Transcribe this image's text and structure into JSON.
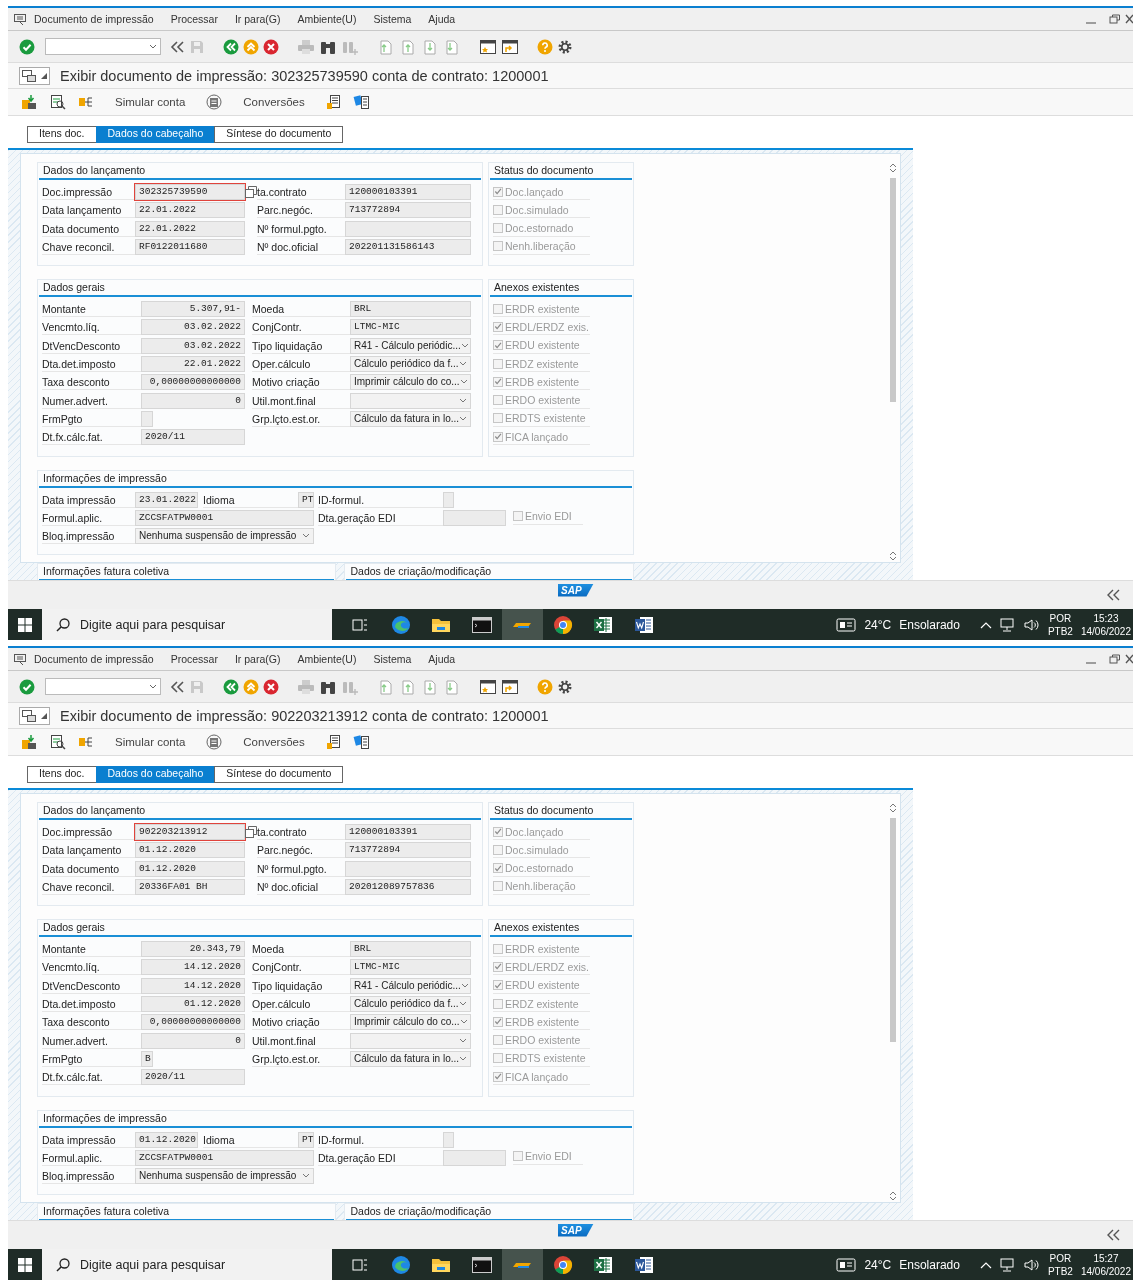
{
  "screens": [
    {
      "menu": [
        "Documento de impressão",
        "Processar",
        "Ir para(G)",
        "Ambiente(U)",
        "Sistema",
        "Ajuda"
      ],
      "title": "Exibir documento de impressão: 302325739590 conta de contrato: 1200001",
      "app_toolbar": [
        "Simular conta",
        "Conversões"
      ],
      "tabs": [
        {
          "label": "Itens doc.",
          "selected": false
        },
        {
          "label": "Dados do cabeçalho",
          "selected": true
        },
        {
          "label": "Síntese do documento",
          "selected": false
        }
      ],
      "posting": {
        "title": "Dados do lançamento",
        "rows": [
          {
            "label": "Doc.impressão",
            "value": "302325739590",
            "focused": true,
            "label2": "ta.contrato",
            "value2": "120000103391"
          },
          {
            "label": "Data lançamento",
            "value": "22.01.2022",
            "focused": false,
            "label2": "Parc.negóc.",
            "value2": "713772894"
          },
          {
            "label": "Data documento",
            "value": "22.01.2022",
            "focused": false,
            "label2": "Nº formul.pgto."
          },
          {
            "label": "Chave reconcil.",
            "value": "RF0122011680",
            "focused": false,
            "label2": "Nº doc.oficial",
            "value2": "202201131586143"
          }
        ]
      },
      "status": {
        "title": "Status do documento",
        "items": [
          {
            "label": "Doc.lançado",
            "checked": true
          },
          {
            "label": "Doc.simulado",
            "checked": false
          },
          {
            "label": "Doc.estornado",
            "checked": false
          },
          {
            "label": "Nenh.liberação",
            "checked": false
          }
        ]
      },
      "general": {
        "title": "Dados gerais",
        "rows": [
          {
            "label": "Montante",
            "kind": "amount",
            "value": "5.307,91-",
            "right": {
              "label": "Moeda",
              "kind": "text",
              "value": "BRL"
            }
          },
          {
            "label": "Vencmto.líq.",
            "kind": "amount",
            "value": "03.02.2022",
            "right": {
              "label": "ConjContr.",
              "kind": "text",
              "value": "LTMC-MIC"
            }
          },
          {
            "label": "DtVencDesconto",
            "kind": "amount",
            "value": "03.02.2022",
            "right": {
              "label": "Tipo liquidação",
              "kind": "dropdown",
              "value": "R41 - Cálculo periódic..."
            }
          },
          {
            "label": "Dta.det.imposto",
            "kind": "amount",
            "value": "22.01.2022",
            "right": {
              "label": "Oper.cálculo",
              "kind": "dropdown",
              "value": "Cálculo periódico da f..."
            }
          },
          {
            "label": "Taxa desconto",
            "kind": "amount",
            "value": "0,00000000000000",
            "right": {
              "label": "Motivo criação",
              "kind": "dropdown",
              "value": "Imprimir cálculo do co..."
            }
          },
          {
            "label": "Numer.advert.",
            "kind": "amount",
            "value": "0",
            "right": {
              "label": "Util.mont.final",
              "kind": "dropdown"
            }
          },
          {
            "label": "FrmPgto",
            "kind": "short",
            "right": {
              "label": "Grp.lçto.est.or.",
              "kind": "dropdown",
              "value": "Cálculo da fatura in lo..."
            }
          },
          {
            "label": "Dt.fx.cálc.fat.",
            "kind": "text",
            "value": "2020/11"
          }
        ]
      },
      "annexes": {
        "title": "Anexos existentes",
        "items": [
          {
            "label": "ERDR existente",
            "checked": false
          },
          {
            "label": "ERDL/ERDZ exis.",
            "checked": true
          },
          {
            "label": "ERDU existente",
            "checked": true
          },
          {
            "label": "ERDZ existente",
            "checked": false
          },
          {
            "label": "ERDB existente",
            "checked": true
          },
          {
            "label": "ERDO existente",
            "checked": false
          },
          {
            "label": "ERDTS existente",
            "checked": false
          },
          {
            "label": "FICA lançado",
            "checked": true
          }
        ]
      },
      "print_info": {
        "title": "Informações de impressão",
        "print_date_label": "Data impressão",
        "print_date": "23.01.2022",
        "language_label": "Idioma",
        "language": "PT",
        "form_id_label": "ID-formul.",
        "form_label": "Formul.aplic.",
        "form": "ZCCSFATPW0001",
        "edi_date_label": "Dta.geração EDI",
        "edi_send": {
          "label": "Envio EDI",
          "checked": false
        },
        "block_label": "Bloq.impressão",
        "block": "Nenhuma suspensão de impressão"
      },
      "collective_invoice": {
        "title": "Informações fatura coletiva"
      },
      "creation": {
        "title": "Dados de criação/modificação"
      },
      "footer": {
        "logo": "SAP"
      },
      "taskbar": {
        "search_placeholder": "Digite aqui para pesquisar",
        "temperature": "24°C",
        "weather": "Ensolarado",
        "language": "POR",
        "keyboard": "PTB2",
        "time": "15:23",
        "date": "14/06/2022"
      }
    },
    {
      "menu": [
        "Documento de impressão",
        "Processar",
        "Ir para(G)",
        "Ambiente(U)",
        "Sistema",
        "Ajuda"
      ],
      "title": "Exibir documento de impressão: 902203213912 conta de contrato: 1200001",
      "app_toolbar": [
        "Simular conta",
        "Conversões"
      ],
      "tabs": [
        {
          "label": "Itens doc.",
          "selected": false
        },
        {
          "label": "Dados do cabeçalho",
          "selected": true
        },
        {
          "label": "Síntese do documento",
          "selected": false
        }
      ],
      "posting": {
        "title": "Dados do lançamento",
        "rows": [
          {
            "label": "Doc.impressão",
            "value": "902203213912",
            "focused": true,
            "label2": "ta.contrato",
            "value2": "120000103391"
          },
          {
            "label": "Data lançamento",
            "value": "01.12.2020",
            "focused": false,
            "label2": "Parc.negóc.",
            "value2": "713772894"
          },
          {
            "label": "Data documento",
            "value": "01.12.2020",
            "focused": false,
            "label2": "Nº formul.pgto."
          },
          {
            "label": "Chave reconcil.",
            "value": "20336FA01 BH",
            "focused": false,
            "label2": "Nº doc.oficial",
            "value2": "202012089757836"
          }
        ]
      },
      "status": {
        "title": "Status do documento",
        "items": [
          {
            "label": "Doc.lançado",
            "checked": true
          },
          {
            "label": "Doc.simulado",
            "checked": false
          },
          {
            "label": "Doc.estornado",
            "checked": true
          },
          {
            "label": "Nenh.liberação",
            "checked": false
          }
        ]
      },
      "general": {
        "title": "Dados gerais",
        "rows": [
          {
            "label": "Montante",
            "kind": "amount",
            "value": "20.343,79",
            "right": {
              "label": "Moeda",
              "kind": "text",
              "value": "BRL"
            }
          },
          {
            "label": "Vencmto.líq.",
            "kind": "amount",
            "value": "14.12.2020",
            "right": {
              "label": "ConjContr.",
              "kind": "text",
              "value": "LTMC-MIC"
            }
          },
          {
            "label": "DtVencDesconto",
            "kind": "amount",
            "value": "14.12.2020",
            "right": {
              "label": "Tipo liquidação",
              "kind": "dropdown",
              "value": "R41 - Cálculo periódic..."
            }
          },
          {
            "label": "Dta.det.imposto",
            "kind": "amount",
            "value": "01.12.2020",
            "right": {
              "label": "Oper.cálculo",
              "kind": "dropdown",
              "value": "Cálculo periódico da f..."
            }
          },
          {
            "label": "Taxa desconto",
            "kind": "amount",
            "value": "0,00000000000000",
            "right": {
              "label": "Motivo criação",
              "kind": "dropdown",
              "value": "Imprimir cálculo do co..."
            }
          },
          {
            "label": "Numer.advert.",
            "kind": "amount",
            "value": "0",
            "right": {
              "label": "Util.mont.final",
              "kind": "dropdown"
            }
          },
          {
            "label": "FrmPgto",
            "kind": "short",
            "value": "B",
            "right": {
              "label": "Grp.lçto.est.or.",
              "kind": "dropdown",
              "value": "Cálculo da fatura in lo..."
            }
          },
          {
            "label": "Dt.fx.cálc.fat.",
            "kind": "text",
            "value": "2020/11"
          }
        ]
      },
      "annexes": {
        "title": "Anexos existentes",
        "items": [
          {
            "label": "ERDR existente",
            "checked": false
          },
          {
            "label": "ERDL/ERDZ exis.",
            "checked": true
          },
          {
            "label": "ERDU existente",
            "checked": true
          },
          {
            "label": "ERDZ existente",
            "checked": false
          },
          {
            "label": "ERDB existente",
            "checked": true
          },
          {
            "label": "ERDO existente",
            "checked": false
          },
          {
            "label": "ERDTS existente",
            "checked": false
          },
          {
            "label": "FICA lançado",
            "checked": true
          }
        ]
      },
      "print_info": {
        "title": "Informações de impressão",
        "print_date_label": "Data impressão",
        "print_date": "01.12.2020",
        "language_label": "Idioma",
        "language": "PT",
        "form_id_label": "ID-formul.",
        "form_label": "Formul.aplic.",
        "form": "ZCCSFATPW0001",
        "edi_date_label": "Dta.geração EDI",
        "edi_send": {
          "label": "Envio EDI",
          "checked": false
        },
        "block_label": "Bloq.impressão",
        "block": "Nenhuma suspensão de impressão"
      },
      "collective_invoice": {
        "title": "Informações fatura coletiva"
      },
      "creation": {
        "title": "Dados de criação/modificação"
      },
      "footer": {
        "logo": "SAP"
      },
      "taskbar": {
        "search_placeholder": "Digite aqui para pesquisar",
        "temperature": "24°C",
        "weather": "Ensolarado",
        "language": "POR",
        "keyboard": "PTB2",
        "time": "15:27",
        "date": "14/06/2022"
      }
    }
  ]
}
